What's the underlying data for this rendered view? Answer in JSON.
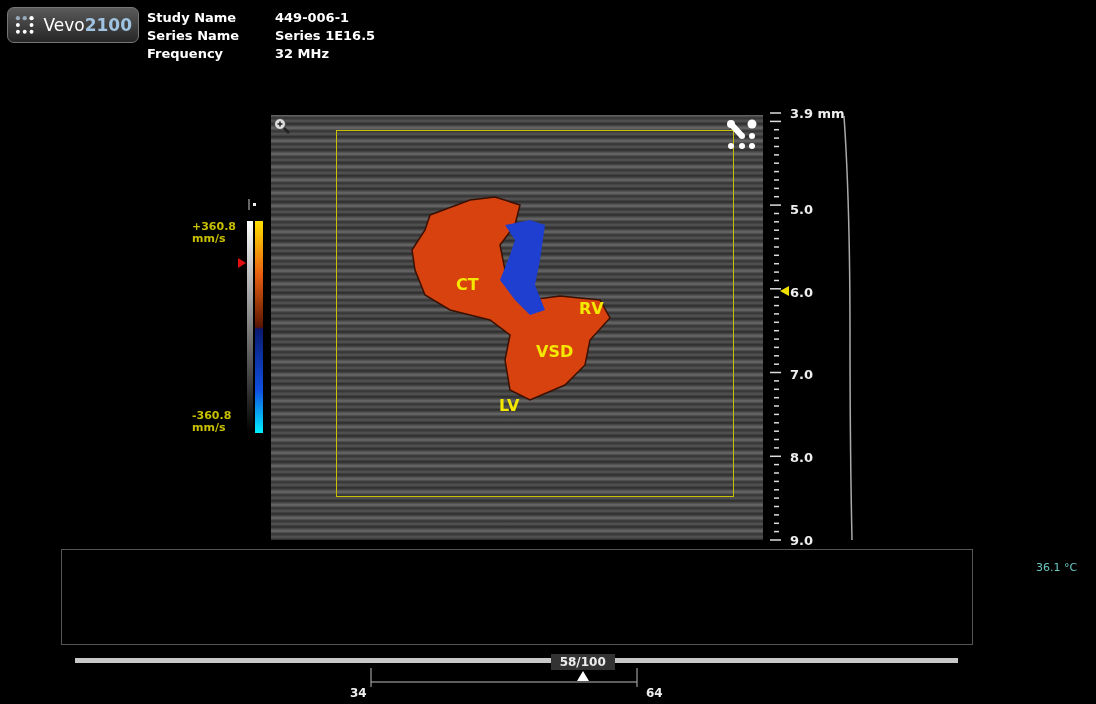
{
  "logo": {
    "name": "Vevo",
    "model": "2100"
  },
  "study_info": [
    {
      "label": "Study Name",
      "value": "449-006-1"
    },
    {
      "label": "Series Name",
      "value": "Series 1E16.5"
    },
    {
      "label": "Frequency",
      "value": "32 MHz"
    }
  ],
  "color_scale": {
    "max": "+360.8",
    "max_unit": "mm/s",
    "min": "-360.8",
    "min_unit": "mm/s"
  },
  "image_labels": [
    {
      "text": "CT"
    },
    {
      "text": "RV"
    },
    {
      "text": "VSD"
    },
    {
      "text": "LV"
    }
  ],
  "depth_scale": [
    "3.9 mm",
    "5.0",
    "6.0",
    "7.0",
    "8.0",
    "9.0"
  ],
  "temperature": "36.1 °C",
  "frame_slider": {
    "level": 0.575,
    "reading": "58/100",
    "range_start": "34",
    "range_end": "64"
  }
}
